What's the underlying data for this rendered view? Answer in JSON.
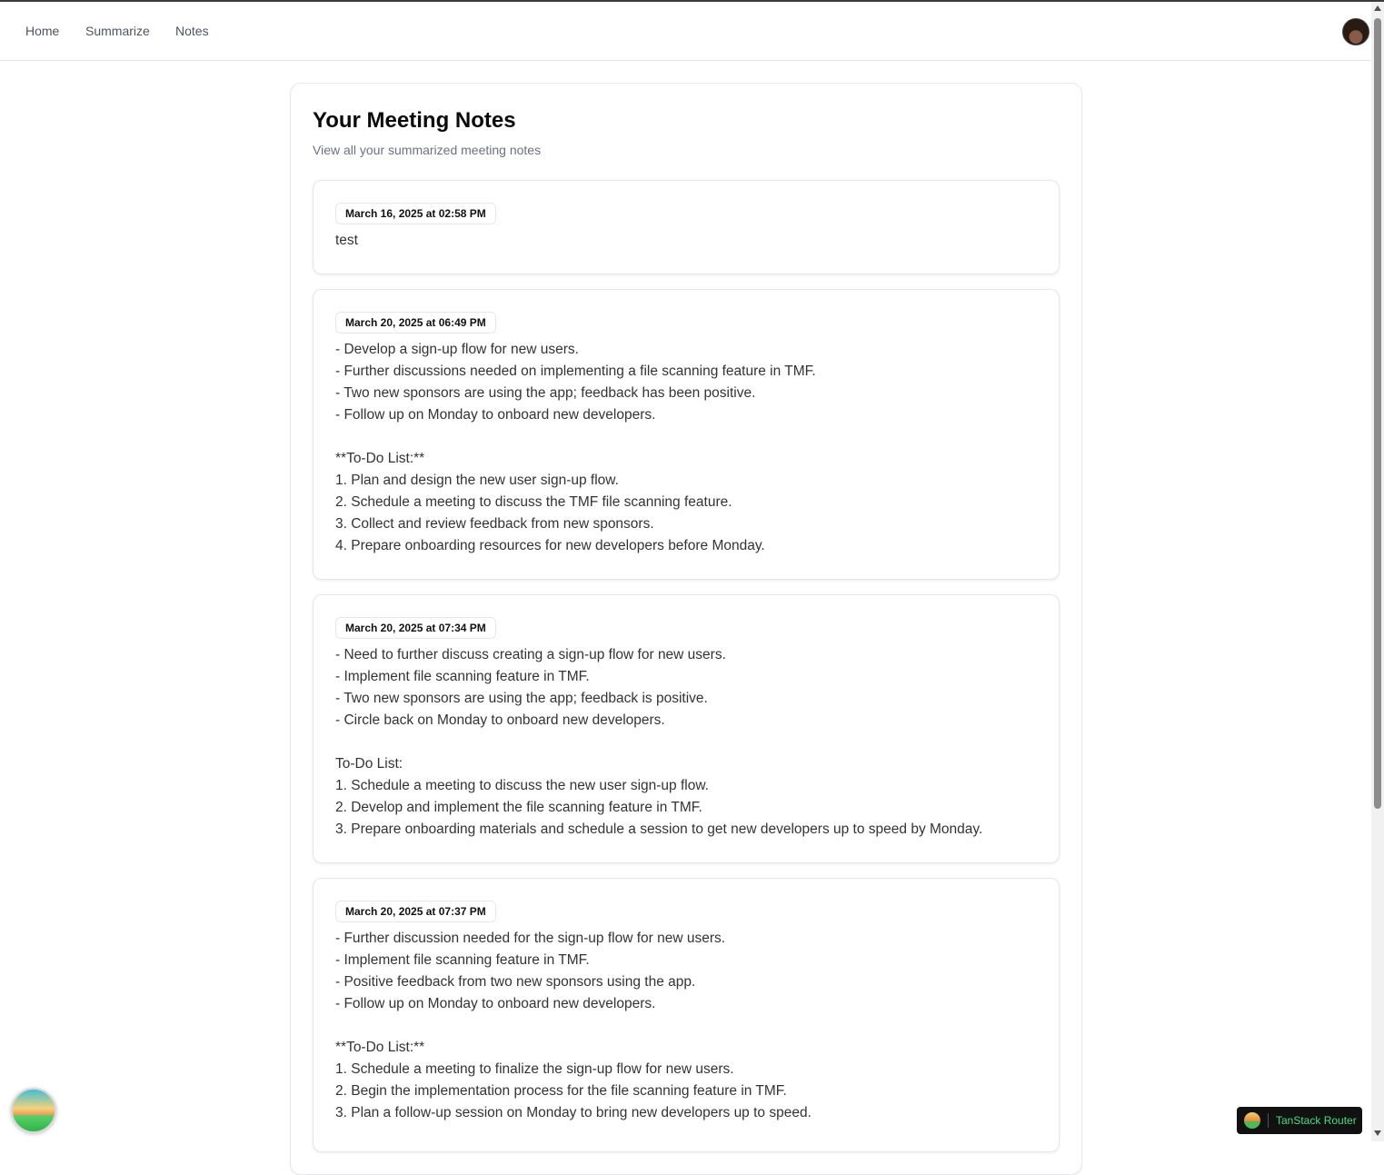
{
  "nav": {
    "links": [
      "Home",
      "Summarize",
      "Notes"
    ]
  },
  "page": {
    "title": "Your Meeting Notes",
    "subtitle": "View all your summarized meeting notes"
  },
  "notes": [
    {
      "date": "March 16, 2025 at 02:58 PM",
      "text": "test"
    },
    {
      "date": "March 20, 2025 at 06:49 PM",
      "text": "- Develop a sign-up flow for new users.\n- Further discussions needed on implementing a file scanning feature in TMF.\n- Two new sponsors are using the app; feedback has been positive.\n- Follow up on Monday to onboard new developers.\n\n**To-Do List:**\n1. Plan and design the new user sign-up flow.\n2. Schedule a meeting to discuss the TMF file scanning feature.\n3. Collect and review feedback from new sponsors.\n4. Prepare onboarding resources for new developers before Monday."
    },
    {
      "date": "March 20, 2025 at 07:34 PM",
      "text": "- Need to further discuss creating a sign-up flow for new users.\n- Implement file scanning feature in TMF.\n- Two new sponsors are using the app; feedback is positive.\n- Circle back on Monday to onboard new developers.\n\nTo-Do List:\n1. Schedule a meeting to discuss the new user sign-up flow.\n2. Develop and implement the file scanning feature in TMF.\n3. Prepare onboarding materials and schedule a session to get new developers up to speed by Monday."
    },
    {
      "date": "March 20, 2025 at 07:37 PM",
      "text": "- Further discussion needed for the sign-up flow for new users.\n- Implement file scanning feature in TMF.\n- Positive feedback from two new sponsors using the app.\n- Follow up on Monday to onboard new developers.\n\n**To-Do List:**\n1. Schedule a meeting to finalize the sign-up flow for new users.\n2. Begin the implementation process for the file scanning feature in TMF.\n3. Plan a follow-up session on Monday to bring new developers up to speed."
    }
  ],
  "devtools": {
    "tanstack_label": "TanStack Router"
  }
}
